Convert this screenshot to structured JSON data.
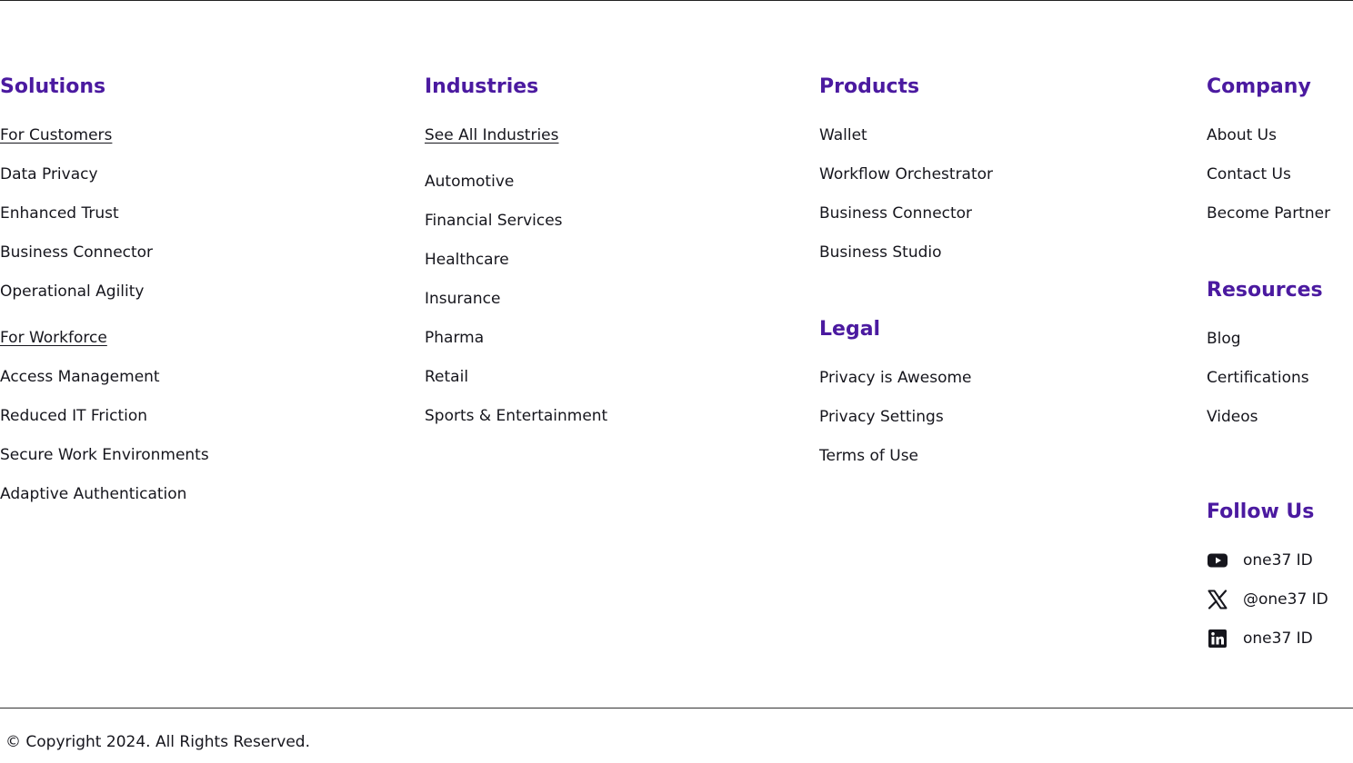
{
  "solutions": {
    "heading": "Solutions",
    "customers_link": "For Customers",
    "customers_items": [
      "Data Privacy",
      "Enhanced Trust",
      "Business Connector",
      "Operational Agility"
    ],
    "workforce_link": "For Workforce",
    "workforce_items": [
      "Access Management",
      "Reduced IT Friction",
      "Secure Work Environments",
      "Adaptive Authentication"
    ]
  },
  "industries": {
    "heading": "Industries",
    "all_link": "See All Industries",
    "items": [
      "Automotive",
      "Financial Services",
      "Healthcare",
      "Insurance",
      "Pharma",
      "Retail",
      "Sports & Entertainment"
    ]
  },
  "products": {
    "heading": "Products",
    "items": [
      "Wallet",
      "Workflow Orchestrator",
      "Business Connector",
      "Business Studio"
    ]
  },
  "legal": {
    "heading": "Legal",
    "items": [
      "Privacy is Awesome",
      "Privacy Settings",
      "Terms of Use"
    ]
  },
  "company": {
    "heading": "Company",
    "items": [
      "About Us",
      "Contact Us",
      "Become Partner"
    ]
  },
  "resources": {
    "heading": "Resources",
    "items": [
      "Blog",
      "Certifications",
      "Videos"
    ]
  },
  "follow": {
    "heading": "Follow Us",
    "items": [
      {
        "icon": "youtube-icon",
        "label": "one37 ID"
      },
      {
        "icon": "x-twitter-icon",
        "label": "@one37 ID"
      },
      {
        "icon": "linkedin-icon",
        "label": "one37 ID"
      }
    ]
  },
  "footer": {
    "copyright": "© Copyright 2024. All Rights Reserved."
  },
  "colors": {
    "heading": "#4b1aa0",
    "text": "#16161d"
  }
}
